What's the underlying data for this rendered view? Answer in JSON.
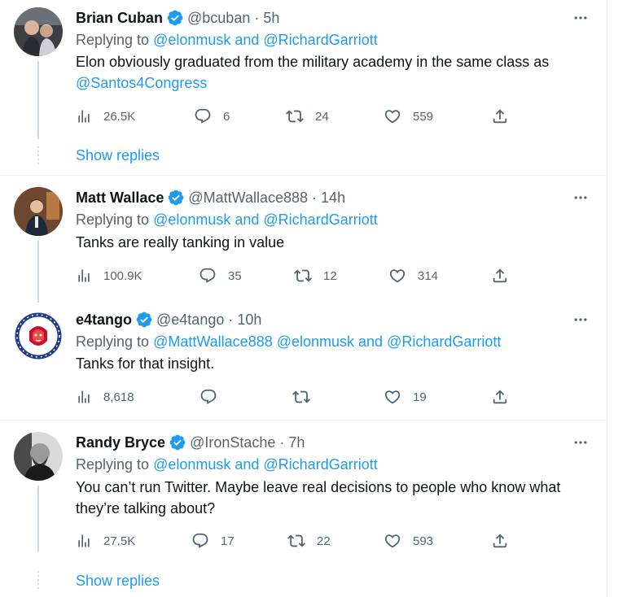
{
  "tweets": [
    {
      "name": "Brian Cuban",
      "handle": "@bcuban",
      "time": "5h",
      "replying_label": "Replying to ",
      "replying_links": "@elonmusk and @RichardGarriott",
      "text_line1": "Elon obviously graduated from the military academy in the same class as",
      "text_link": "@Santos4Congress",
      "views": "26.5K",
      "replies": "6",
      "retweets": "24",
      "likes": "559",
      "show_replies": "Show replies"
    },
    {
      "name": "Matt Wallace",
      "handle": "@MattWallace888",
      "time": "14h",
      "replying_label": "Replying to ",
      "replying_links": "@elonmusk and @RichardGarriott",
      "text_line1": "Tanks are really tanking in value",
      "views": "100.9K",
      "replies": "35",
      "retweets": "12",
      "likes": "314"
    },
    {
      "name": "e4tango",
      "handle": "@e4tango",
      "time": "10h",
      "replying_label": "Replying to ",
      "replying_links": "@MattWallace888 @elonmusk and @RichardGarriott",
      "text_line1": "Tanks for that insight.",
      "views": "8,618",
      "replies": "",
      "retweets": "",
      "likes": "19"
    },
    {
      "name": "Randy Bryce",
      "handle": "@IronStache",
      "time": "7h",
      "replying_label": "Replying to ",
      "replying_links": "@elonmusk and @RichardGarriott",
      "text_line1": "You can’t run Twitter. Maybe leave real decisions to people who know what",
      "text_line2": "they’re talking about?",
      "views": "27.5K",
      "replies": "17",
      "retweets": "22",
      "likes": "593",
      "show_replies": "Show replies"
    }
  ],
  "separator": "·",
  "colors": {
    "link": "#1d9bf0",
    "secondary_text": "#536471",
    "primary_text": "#0f1419",
    "verified_badge": "#1d9bf0",
    "thread_line": "#cfd9de",
    "divider": "#eff3f4"
  },
  "icons": {
    "views": "views-icon",
    "reply": "reply-icon",
    "retweet": "retweet-icon",
    "like": "like-icon",
    "share": "share-icon",
    "more": "more-icon",
    "verified": "verified-badge-icon"
  }
}
